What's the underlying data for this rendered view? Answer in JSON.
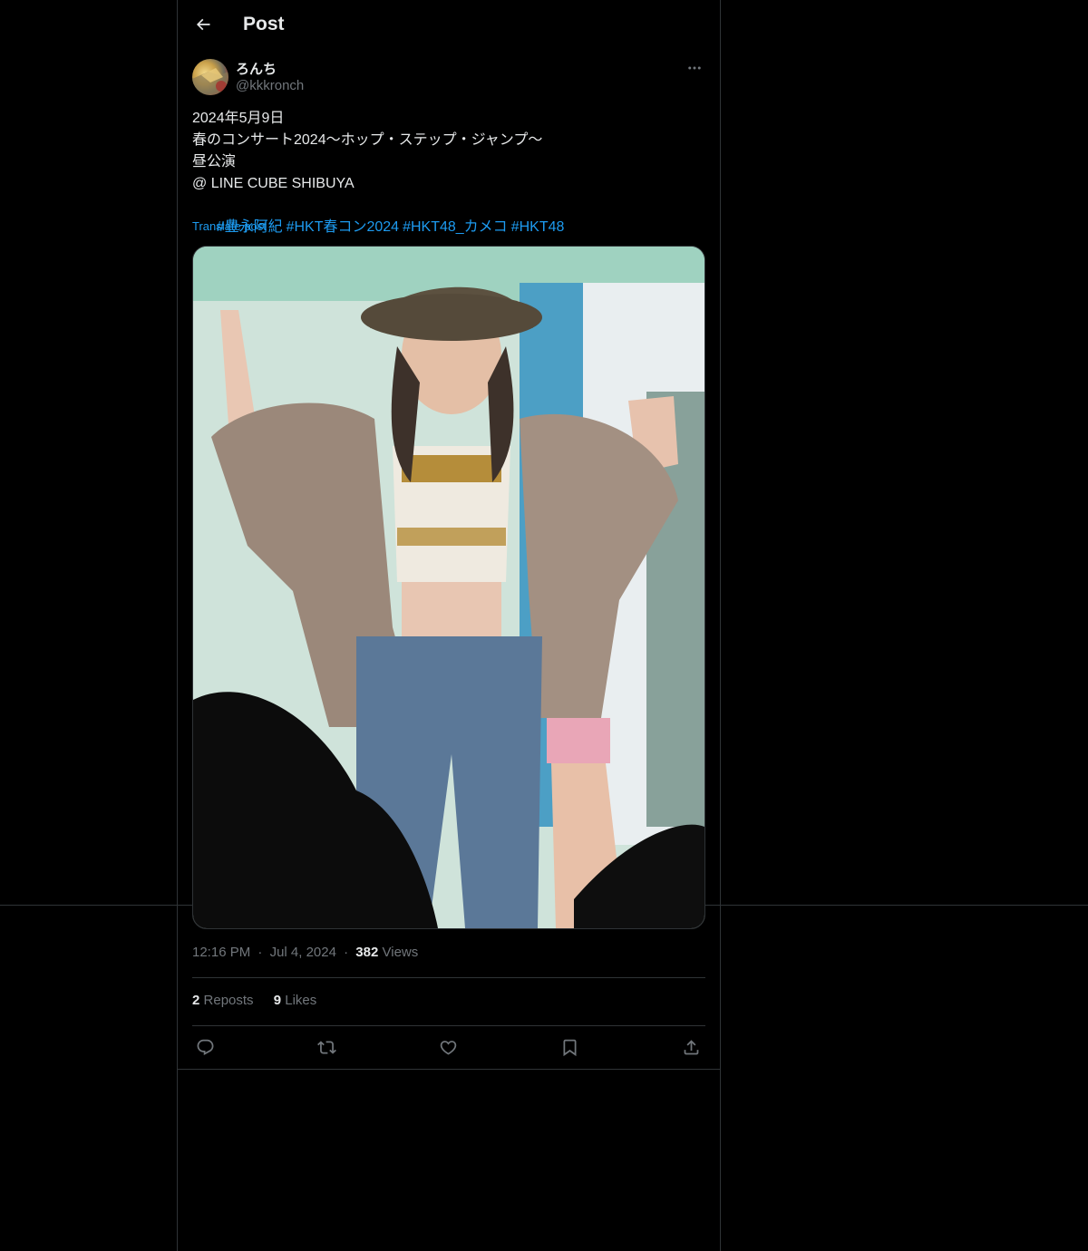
{
  "header": {
    "title": "Post",
    "back_icon": "arrow-left-icon"
  },
  "author": {
    "display_name": "ろんち",
    "handle": "@kkkronch",
    "more_icon": "more-horizontal-icon"
  },
  "post": {
    "lines": [
      "2024年5月9日",
      "春のコンサート2024〜ホップ・ステップ・ジャンプ〜",
      "昼公演",
      "@ LINE CUBE SHIBUYA"
    ],
    "hashtags": [
      "#豊永阿紀",
      "#HKT春コン2024",
      "#HKT48_カメコ",
      "#HKT48"
    ],
    "translate_label": "Translate post"
  },
  "meta": {
    "time": "12:16 PM",
    "separator": "·",
    "date": "Jul 4, 2024",
    "views_count": "382",
    "views_label": "Views"
  },
  "stats": {
    "reposts_count": "2",
    "reposts_label": "Reposts",
    "likes_count": "9",
    "likes_label": "Likes"
  },
  "actions": [
    {
      "name": "reply",
      "icon": "reply-icon"
    },
    {
      "name": "repost",
      "icon": "repost-icon"
    },
    {
      "name": "like",
      "icon": "heart-icon"
    },
    {
      "name": "bookmark",
      "icon": "bookmark-icon"
    },
    {
      "name": "share",
      "icon": "share-icon"
    }
  ],
  "colors": {
    "background": "#000000",
    "text": "#e7e9ea",
    "secondary": "#71767b",
    "accent": "#1d9bf0",
    "border": "#2f3336"
  }
}
